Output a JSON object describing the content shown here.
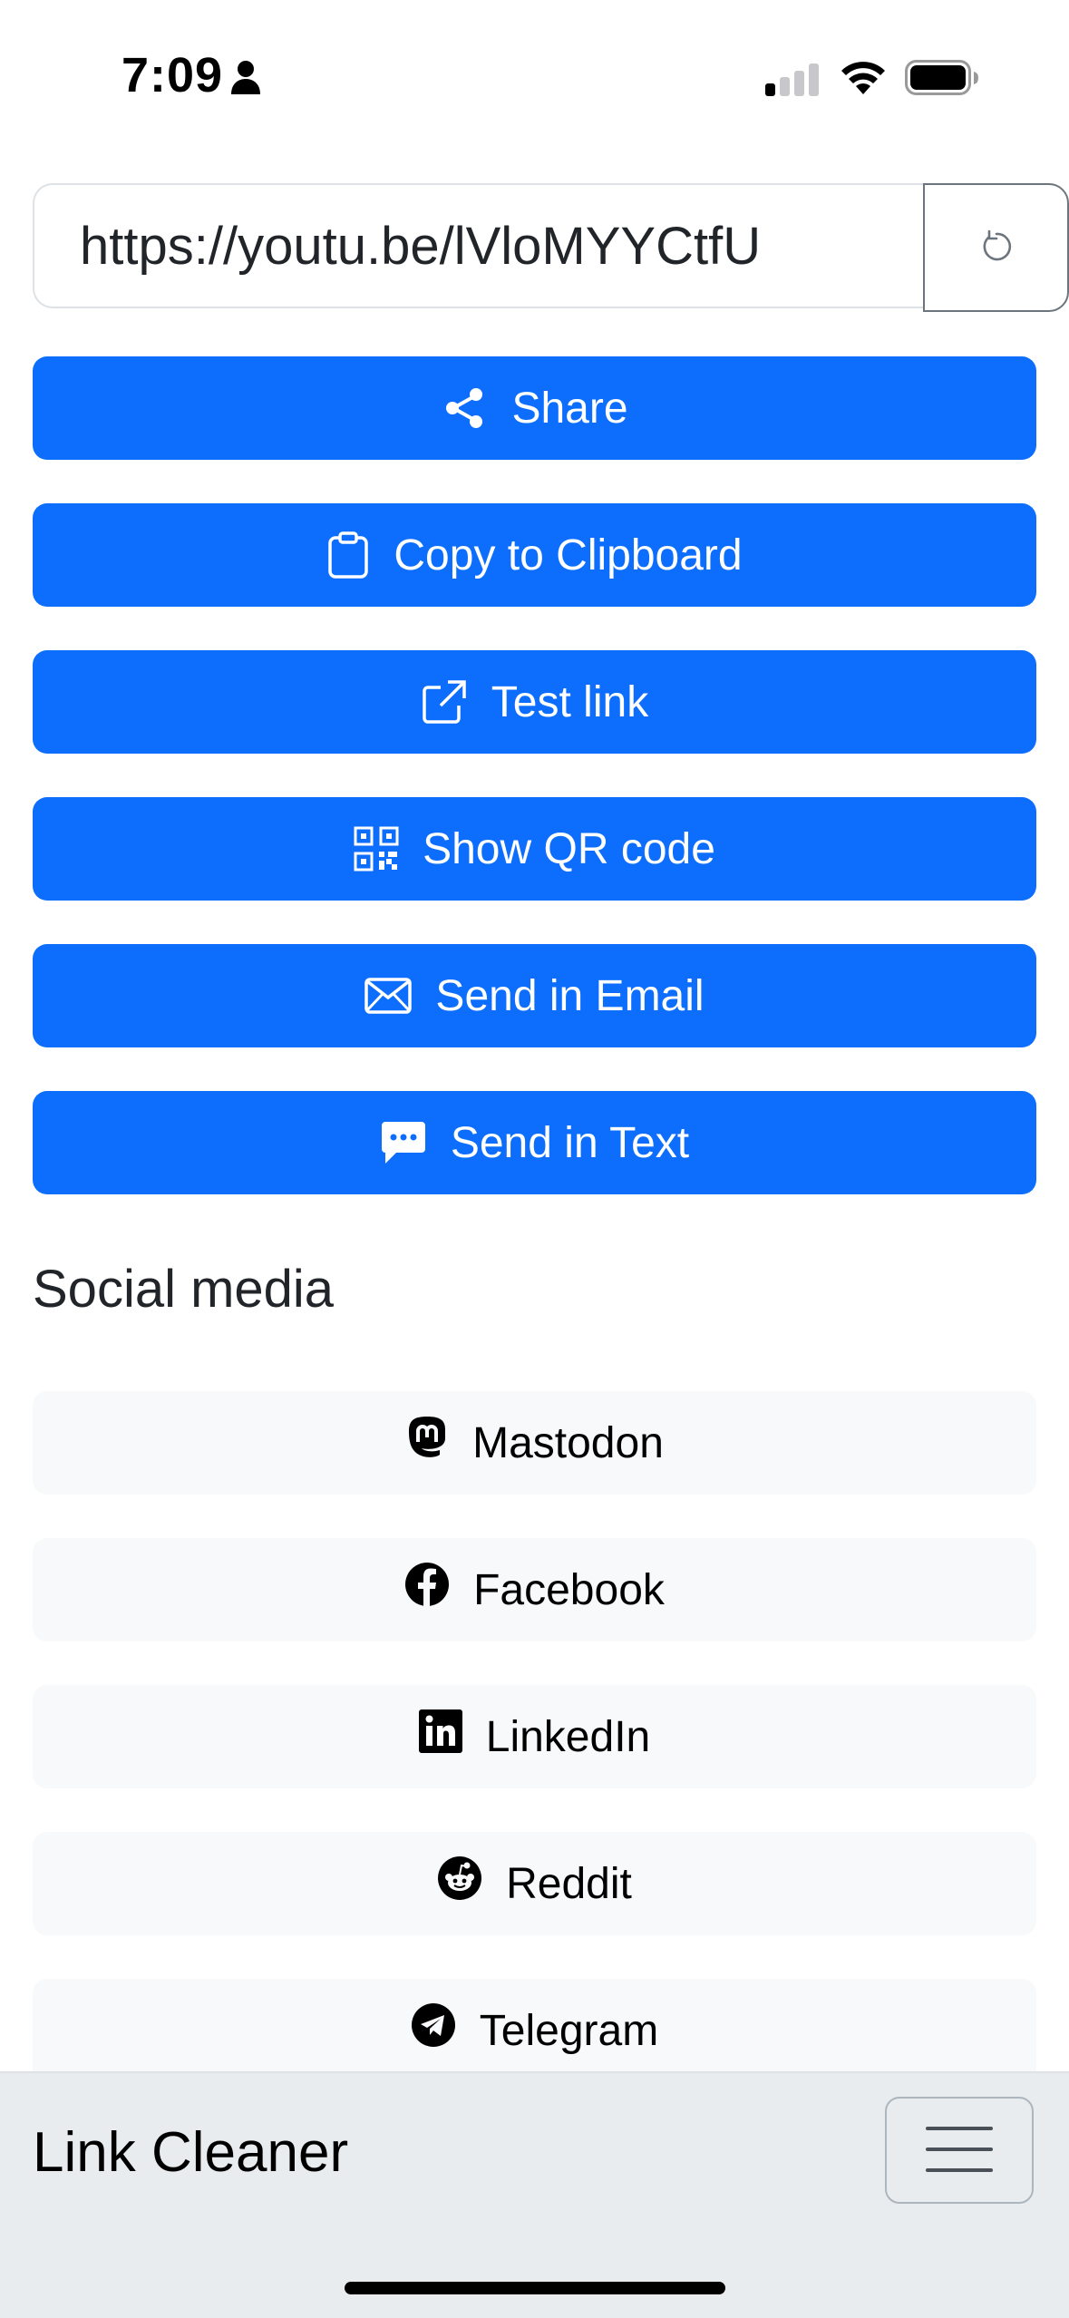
{
  "status_bar": {
    "time": "7:09",
    "icons": [
      "person-icon",
      "cellular-signal-icon",
      "wifi-icon",
      "battery-icon"
    ]
  },
  "url_input": {
    "value": "https://youtu.be/lVloMYYCtfU",
    "reset_icon": "reset-icon"
  },
  "actions": [
    {
      "label": "Share",
      "icon": "share-icon"
    },
    {
      "label": "Copy to Clipboard",
      "icon": "clipboard-icon"
    },
    {
      "label": "Test link",
      "icon": "external-link-icon"
    },
    {
      "label": "Show QR code",
      "icon": "qr-code-icon"
    },
    {
      "label": "Send in Email",
      "icon": "envelope-icon"
    },
    {
      "label": "Send in Text",
      "icon": "chat-dots-icon"
    }
  ],
  "social": {
    "title": "Social media",
    "items": [
      {
        "label": "Mastodon",
        "icon": "mastodon-icon"
      },
      {
        "label": "Facebook",
        "icon": "facebook-icon"
      },
      {
        "label": "LinkedIn",
        "icon": "linkedin-icon"
      },
      {
        "label": "Reddit",
        "icon": "reddit-icon"
      },
      {
        "label": "Telegram",
        "icon": "telegram-icon"
      }
    ]
  },
  "navbar": {
    "brand": "Link Cleaner",
    "toggler_icon": "hamburger-menu-icon"
  },
  "colors": {
    "primary": "#0d6efd",
    "light_button": "#f8f9fa",
    "navbar_bg": "#e9ecef",
    "text": "#212529"
  }
}
